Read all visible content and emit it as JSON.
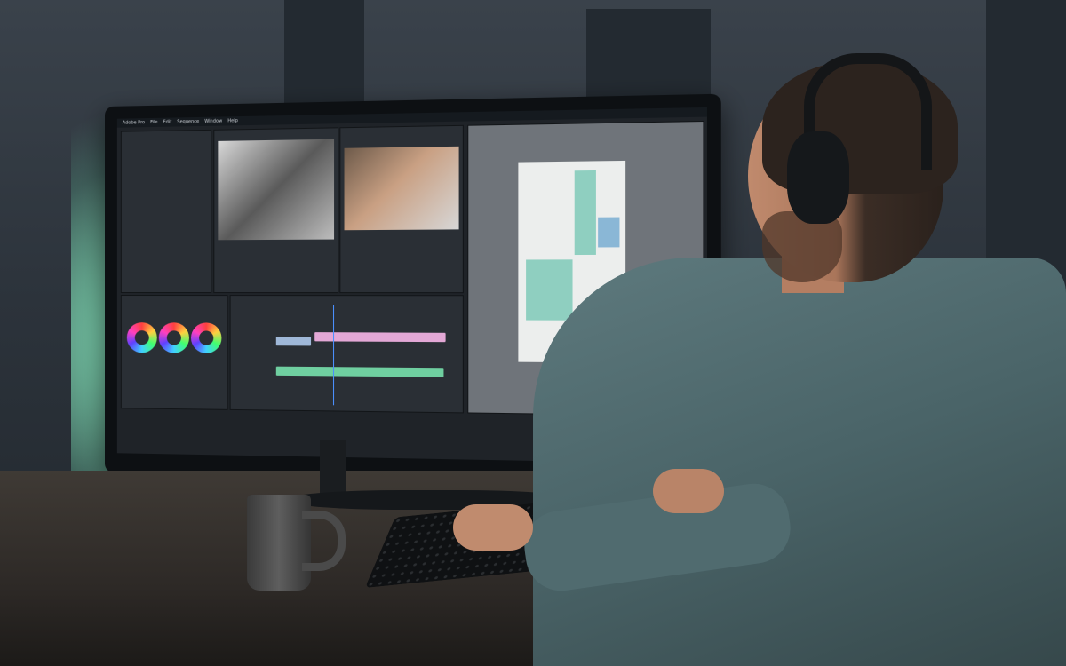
{
  "scene": {
    "subject": "person-at-monitor",
    "accent_glow": "#7fd9b3"
  },
  "screen": {
    "menu": [
      "Adobe Pro",
      "File",
      "Edit",
      "Sequence",
      "Window",
      "Help"
    ]
  }
}
